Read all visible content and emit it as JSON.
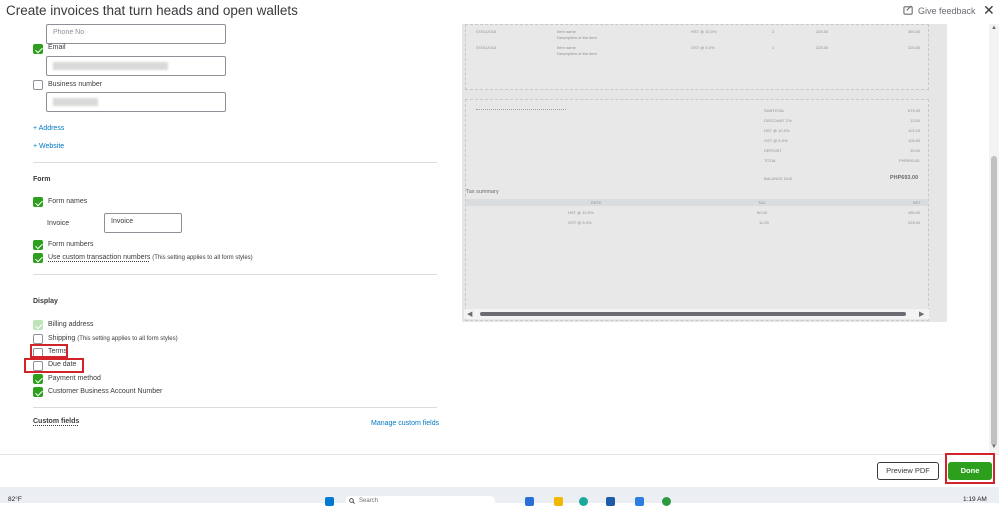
{
  "header": {
    "title": "Create invoices that turn heads and open wallets",
    "feedback_label": "Give feedback"
  },
  "contact": {
    "phone_placeholder": "Phone No",
    "email_label": "Email",
    "business_number_label": "Business number",
    "add_address": "+ Address",
    "add_website": "+ Website"
  },
  "form_section": {
    "heading": "Form",
    "form_names_label": "Form names",
    "invoice_label": "Invoice",
    "invoice_value": "Invoice",
    "form_numbers_label": "Form numbers",
    "custom_txn_label": "Use custom transaction numbers",
    "custom_txn_hint": "(This setting applies to all form styles)"
  },
  "display_section": {
    "heading": "Display",
    "billing_address": "Billing address",
    "shipping": "Shipping",
    "shipping_hint": "(This setting applies to all form styles)",
    "terms": "Terms",
    "due_date": "Due date",
    "payment_method": "Payment method",
    "customer_business_account_number": "Customer Business Account Number"
  },
  "custom_fields": {
    "heading": "Custom fields",
    "manage_link": "Manage custom fields"
  },
  "preview": {
    "rows": [
      {
        "date": "07/01/2018",
        "item": "Item name",
        "desc": "Description of the item",
        "tax": "HST @ 10.0%",
        "qty": "2",
        "rate": "225.00",
        "amount": "450.00"
      },
      {
        "date": "07/01/2018",
        "item": "Item name",
        "desc": "Description of the item",
        "tax": "GST @ 5.0%",
        "qty": "1",
        "rate": "225.00",
        "amount": "225.00"
      }
    ],
    "totals": [
      {
        "label": "SUBTOTAL",
        "value": "675.00"
      },
      {
        "label": "DISCOUNT 2%",
        "value": "13.50"
      },
      {
        "label": "HST @ 10.0%",
        "value": "113.00"
      },
      {
        "label": "GST @ 5.0%",
        "value": "105.00"
      },
      {
        "label": "DEPOSIT",
        "value": "10.00"
      },
      {
        "label": "TOTAL",
        "value": "PHP693.00"
      }
    ],
    "balance_due_label": "BALANCE DUE",
    "balance_due_value": "PHP693.00",
    "tax_summary_title": "Tax summary",
    "tax_headers": [
      "RATE",
      "TAX",
      "NET"
    ],
    "tax_rows": [
      {
        "rate": "HST @ 10.0%",
        "tax": "60.00",
        "net": "450.00"
      },
      {
        "rate": "GST @ 5.0%",
        "tax": "11.25",
        "net": "225.00"
      }
    ]
  },
  "footer": {
    "preview_pdf": "Preview PDF",
    "done": "Done"
  },
  "taskbar": {
    "temperature": "82°F",
    "search_placeholder": "Search",
    "time": "1:19 AM"
  },
  "colors": {
    "accent_green": "#2ca01c",
    "link_blue": "#0077c5",
    "highlight_red": "#d2232a"
  }
}
